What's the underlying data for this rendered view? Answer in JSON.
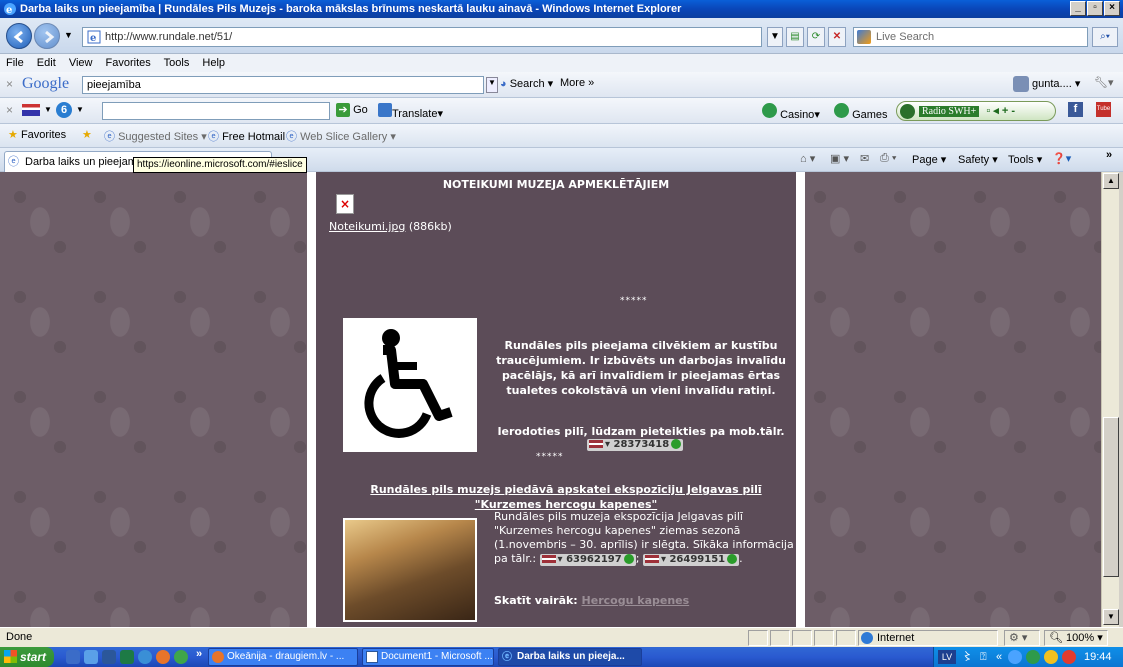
{
  "window": {
    "title": "Darba laiks un pieejamība | Rundāles Pils Muzejs - baroka mākslas brīnums neskartā lauku ainavā - Windows Internet Explorer"
  },
  "address": {
    "url": "http://www.rundale.net/51/",
    "live_search_placeholder": "Live Search"
  },
  "menu": [
    "File",
    "Edit",
    "View",
    "Favorites",
    "Tools",
    "Help"
  ],
  "google_toolbar": {
    "logo": "Google",
    "query": "pieejamība",
    "search_label": "Search",
    "more_label": "More »",
    "user": "gunta...."
  },
  "second_toolbar": {
    "go_label": "Go",
    "translate_label": "Translate",
    "casino_label": "Casino",
    "games_label": "Games",
    "radio_label": "Radio SWH+"
  },
  "favorites_bar": {
    "favorites_label": "Favorites",
    "items": [
      "Suggested Sites",
      "Free Hotmail",
      "Web Slice Gallery"
    ]
  },
  "tabs": {
    "active_tab": "Darba laiks un pieejamība",
    "tooltip": "https://ieonline.microsoft.com/#ieslice",
    "commands": [
      "Page",
      "Safety",
      "Tools"
    ]
  },
  "page": {
    "heading": "NOTEIKUMI MUZEJA APMEKLĒTĀJIEM",
    "file_link": "Noteikumi.jpg",
    "file_size": "(886kb)",
    "stars": "*****",
    "access_text": "Rundāles pils pieejama cilvēkiem ar kustību traucējumiem. Ir izbūvēts un darbojas invalīdu pacēlājs, kā arī invalīdiem ir pieejamas ērtas tualetes cokolstāvā un vieni invalīdu ratiņi.",
    "phone_prompt": "Ierodoties pilī, lūdzam pieteikties pa mob.tālr.",
    "phone1": "28373418",
    "jelgava_link": "Rundāles pils muzejs piedāvā apskatei ekspozīciju Jelgavas pilī \"Kurzemes hercogu kapenes\"",
    "jelgava_text": "Rundāles pils muzeja ekspozīcija Jelgavas pilī \"Kurzemes hercogu kapenes\" ziemas sezonā (1.novembris – 30. aprīlis) ir slēgta. Sīkāka informācija pa tālr.:",
    "phone2": "63962197",
    "phone3": "26499151",
    "see_more_label": "Skatīt vairāk:",
    "see_more_link": "Hercogu kapenes"
  },
  "statusbar": {
    "status": "Done",
    "zone": "Internet",
    "zoom": "100%"
  },
  "taskbar": {
    "start_label": "start",
    "items": [
      "Okeānija - draugiem.lv - ...",
      "Document1 - Microsoft ...",
      "Darba laiks un pieeja..."
    ],
    "lang": "LV",
    "clock": "19:44"
  }
}
